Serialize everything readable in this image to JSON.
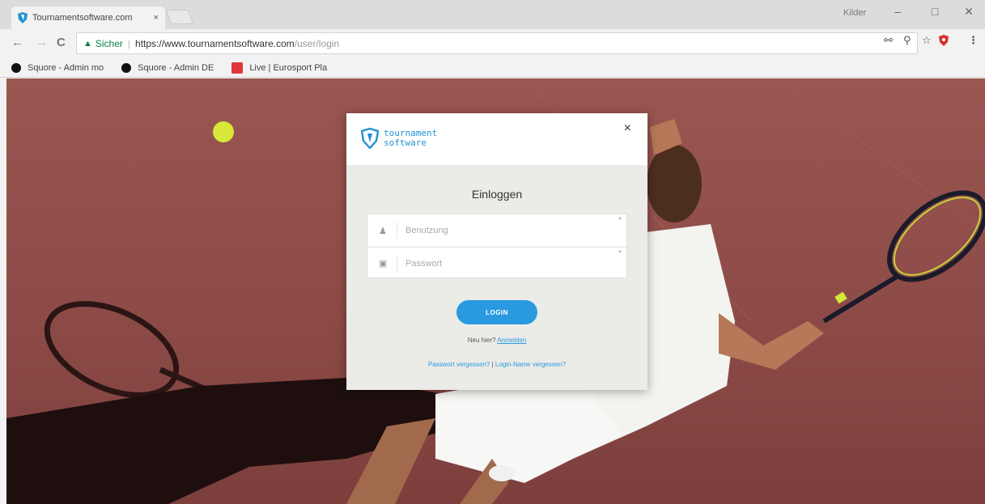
{
  "browser": {
    "tab_title": "Tournamentsoftware.com",
    "tab_close": "×",
    "profile_name": "Kilder",
    "win_minimize": "–",
    "win_restore": "□",
    "win_close": "✕",
    "back": "←",
    "forward": "→",
    "reload": "C",
    "secure_label": "Sicher",
    "url_main": "https://www.tournamentsoftware.com",
    "url_path": "/user/login",
    "icons": [
      "key-icon",
      "zoom-icon",
      "star-icon",
      "extension-shield-icon",
      "menu-icon"
    ]
  },
  "bookmarks": [
    {
      "label": "Squore - Admin mo",
      "icon": "squore-icon"
    },
    {
      "label": "Squore - Admin DE",
      "icon": "squore-icon"
    },
    {
      "label": "Live | Eurosport Pla",
      "icon": "eurosport-icon"
    }
  ],
  "modal": {
    "logo_line1": "tournament",
    "logo_line2": "software",
    "close": "×",
    "title": "Einloggen",
    "username_placeholder": "Benutzung",
    "password_placeholder": "Passwort",
    "login_button": "LOGIN",
    "new_prefix": "Neu hier?",
    "register_link": "Anmelden",
    "forgot_password": "Passwort vergessen?",
    "forgot_sep": "|",
    "forgot_login": "Login-Name vergessen?"
  },
  "colors": {
    "brand_blue": "#2a9ae0",
    "court": "#8d4b47",
    "ball": "#d8e83a"
  }
}
